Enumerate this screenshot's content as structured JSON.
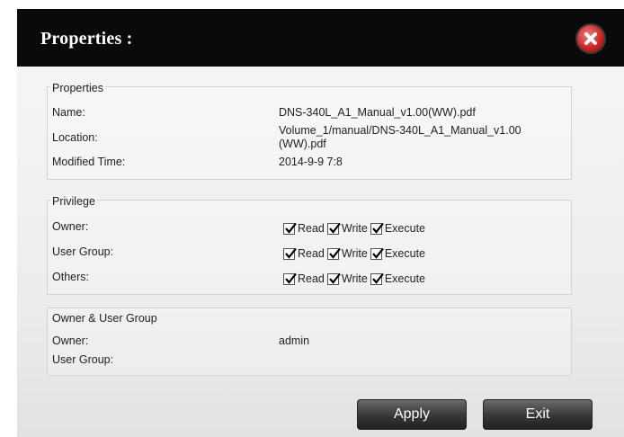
{
  "dialog": {
    "title": "Properties :"
  },
  "properties": {
    "legend": "Properties",
    "name_label": "Name:",
    "name_value": "DNS-340L_A1_Manual_v1.00(WW).pdf",
    "location_label": "Location:",
    "location_value_line1": "Volume_1/manual/DNS-340L_A1_Manual_v1.00",
    "location_value_line2": "(WW).pdf",
    "modified_label": "Modified Time:",
    "modified_value": "2014-9-9 7:8"
  },
  "privilege": {
    "legend": "Privilege",
    "read_label": "Read",
    "write_label": "Write",
    "execute_label": "Execute",
    "rows": [
      {
        "label": "Owner:",
        "read": true,
        "write": true,
        "execute": true
      },
      {
        "label": "User Group:",
        "read": true,
        "write": true,
        "execute": true
      },
      {
        "label": "Others:",
        "read": true,
        "write": true,
        "execute": true
      }
    ]
  },
  "ownership": {
    "legend": "Owner & User Group",
    "owner_label": "Owner:",
    "owner_value": "admin",
    "group_label": "User Group:",
    "group_value": ""
  },
  "buttons": {
    "apply": "Apply",
    "exit": "Exit"
  },
  "icons": {
    "close": "close-icon",
    "checkbox": "check-icon"
  },
  "colors": {
    "titlebar": "#0a0a0a",
    "close": "#c9211f",
    "button": "#3a3a3a"
  }
}
